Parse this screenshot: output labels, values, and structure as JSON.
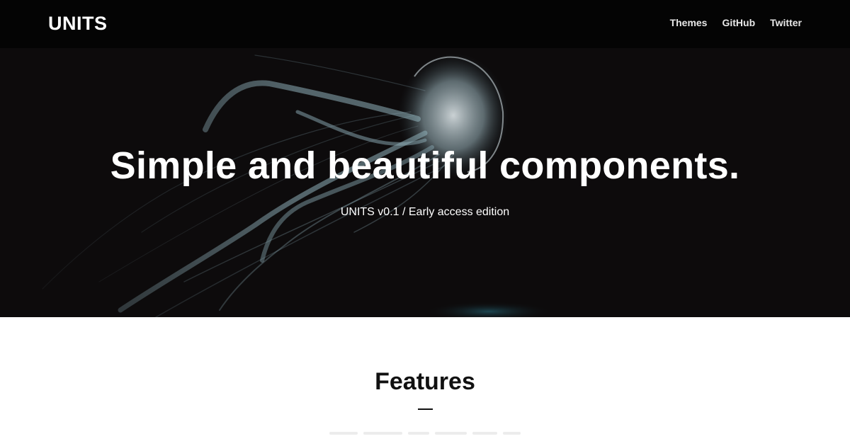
{
  "navbar": {
    "brand": "UNITS",
    "links": [
      {
        "label": "Themes"
      },
      {
        "label": "GitHub"
      },
      {
        "label": "Twitter"
      }
    ]
  },
  "hero": {
    "title": "Simple and beautiful components.",
    "subtitle": "UNITS v0.1 / Early access edition",
    "image": "jellyfish-photo",
    "background_color": "#0d0b0c"
  },
  "features": {
    "title": "Features"
  },
  "colors": {
    "navbar_bg": "#040404",
    "text_light": "#ffffff",
    "text_dark": "#111111",
    "jellyfish_tint": "#7fa7b3"
  }
}
